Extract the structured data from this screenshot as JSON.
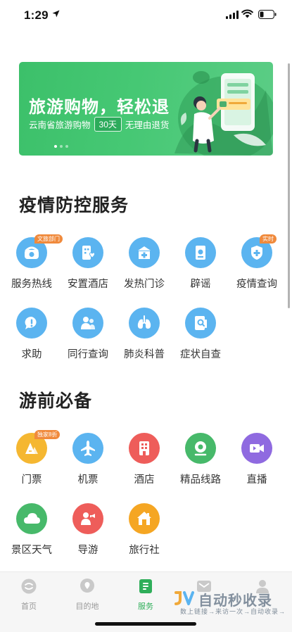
{
  "status_bar": {
    "time": "1:29"
  },
  "banner": {
    "title": "旅游购物，轻松退",
    "subtitle_left": "云南省旅游购物",
    "subtitle_pill": "30天",
    "subtitle_right": "无理由退货"
  },
  "sections": {
    "epidemic": {
      "title": "疫情防控服务",
      "items": [
        {
          "label": "服务热线",
          "badge": "文旅部门",
          "icon": "phone-icon",
          "color": "#5bb4f0"
        },
        {
          "label": "安置酒店",
          "badge": "",
          "icon": "hotel-heart-icon",
          "color": "#5bb4f0"
        },
        {
          "label": "发热门诊",
          "badge": "",
          "icon": "clinic-icon",
          "color": "#5bb4f0"
        },
        {
          "label": "辟谣",
          "badge": "",
          "icon": "document-icon",
          "color": "#5bb4f0"
        },
        {
          "label": "疫情查询",
          "badge": "实时",
          "icon": "shield-icon",
          "color": "#5bb4f0"
        },
        {
          "label": "求助",
          "badge": "",
          "icon": "help-bubble-icon",
          "color": "#5bb4f0"
        },
        {
          "label": "同行查询",
          "badge": "",
          "icon": "fellow-traveler-icon",
          "color": "#5bb4f0"
        },
        {
          "label": "肺炎科普",
          "badge": "",
          "icon": "lungs-icon",
          "color": "#5bb4f0"
        },
        {
          "label": "症状自查",
          "badge": "",
          "icon": "self-check-icon",
          "color": "#5bb4f0"
        }
      ]
    },
    "travel": {
      "title": "游前必备",
      "items": [
        {
          "label": "门票",
          "badge": "独家8折",
          "icon": "ticket-icon",
          "color": "#f5b731"
        },
        {
          "label": "机票",
          "badge": "",
          "icon": "airplane-icon",
          "color": "#5bb4f0"
        },
        {
          "label": "酒店",
          "badge": "",
          "icon": "hotel-icon",
          "color": "#ee5d5a"
        },
        {
          "label": "精品线路",
          "badge": "",
          "icon": "route-icon",
          "color": "#47b96a"
        },
        {
          "label": "直播",
          "badge": "",
          "icon": "video-icon",
          "color": "#8f6ae0"
        },
        {
          "label": "景区天气",
          "badge": "",
          "icon": "cloud-icon",
          "color": "#47b96a"
        },
        {
          "label": "导游",
          "badge": "",
          "icon": "guide-icon",
          "color": "#ee5d5a"
        },
        {
          "label": "旅行社",
          "badge": "",
          "icon": "agency-house-icon",
          "color": "#f5a623"
        }
      ]
    }
  },
  "bottom_nav": {
    "items": [
      {
        "label": "首页",
        "icon": "home-icon",
        "active": false
      },
      {
        "label": "目的地",
        "icon": "location-icon",
        "active": false
      },
      {
        "label": "服务",
        "icon": "service-icon",
        "active": true
      },
      {
        "label": "",
        "icon": "message-icon",
        "active": false
      },
      {
        "label": "",
        "icon": "profile-icon",
        "active": false
      }
    ]
  },
  "watermark": {
    "title": "自动秒收录",
    "subtitle": "数上链接→来访一次→自动收录→"
  },
  "colors": {
    "accent": "#2fae5a",
    "banner_green": "#46c874",
    "badge_orange": "#f08a3c"
  }
}
